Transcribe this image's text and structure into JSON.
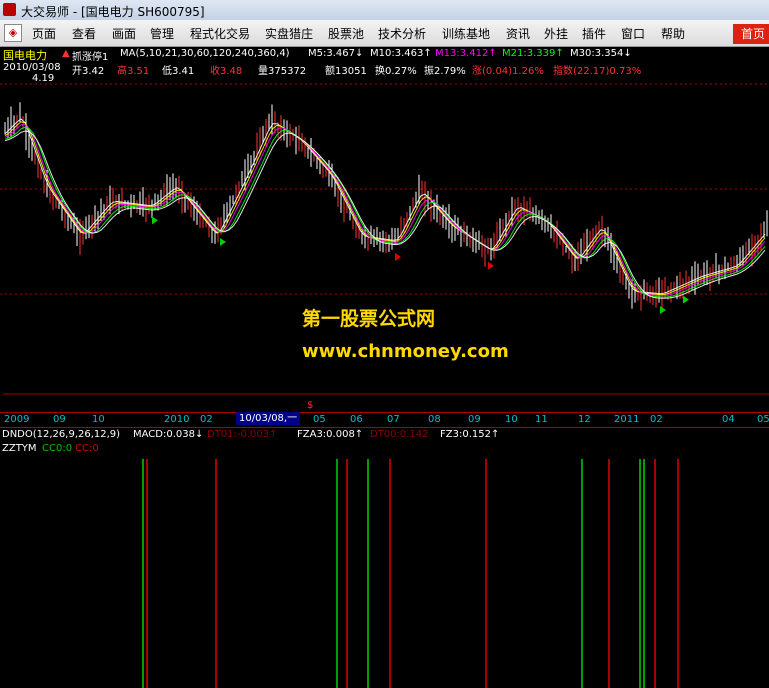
{
  "window": {
    "title": "大交易师 - [国电电力 SH600795]"
  },
  "menu": {
    "items": [
      "页面",
      "查看",
      "画面",
      "管理",
      "程式化交易",
      "实盘猎庄",
      "股票池",
      "技术分析",
      "训练基地",
      "资讯",
      "外挂",
      "插件",
      "窗口",
      "帮助"
    ],
    "home_button": "首页"
  },
  "header": {
    "stock_name": "国电电力",
    "indicator_name": "抓涨停1",
    "ma_params": "MA(5,10,21,30,60,120,240,360,4)",
    "m5": "M5:3.467↓",
    "m10": "M10:3.463↑",
    "m13": "M13:3.412↑",
    "m21": "M21:3.339↑",
    "m30": "M30:3.354↓",
    "date": "2010/03/08",
    "open": "开3.42",
    "high": "高3.51",
    "low": "低3.41",
    "close": "收3.48",
    "volume": "量375372",
    "amount": "额13051",
    "turnover": "换0.27%",
    "amplitude": "振2.79%",
    "change": "涨(0.04)1.26%",
    "index": "指数(22.17)0.73%",
    "high_price_label": "4.19"
  },
  "watermark": {
    "line1": "第一股票公式网",
    "line2": "www.chnmoney.com"
  },
  "date_axis": {
    "labels": [
      "2009",
      "09",
      "10",
      "2010",
      "02",
      "05",
      "06",
      "07",
      "08",
      "09",
      "10",
      "11",
      "12",
      "2011",
      "02",
      "04",
      "05"
    ],
    "cursor_date": "10/03/08,一"
  },
  "indicators": {
    "dndo": "DNDO(12,26,9,26,12,9)",
    "macd": "MACD:0.038↓",
    "dt01": "DT01:-0.003↑",
    "fza3": "FZA3:0.008↑",
    "dt00": "DT00:0.142",
    "fz3": "FZ3:0.152↑",
    "zzt_name": "ZZTYM",
    "cc0": "CC0:0",
    "cc": "CC:0"
  },
  "colors": {
    "up": "#ff3232",
    "down": "#ffffff",
    "ma5": "#ffffff",
    "ma10": "#ffff00",
    "ma13": "#ff00ff",
    "ma21": "#00ff00",
    "ma30": "#ffffff",
    "signal_green": "#00d000",
    "signal_red": "#e00000",
    "axis": "#00c0c0"
  },
  "icons": {
    "app": "app-logo-icon",
    "system_menu": "system-menu-icon"
  }
}
